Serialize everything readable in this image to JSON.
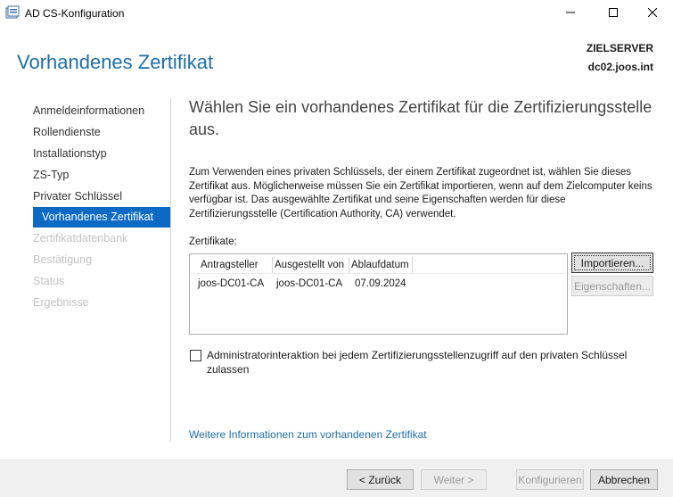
{
  "window": {
    "title": "AD CS-Konfiguration"
  },
  "header": {
    "page_heading": "Vorhandenes Zertifikat",
    "target_label": "ZIELSERVER",
    "target_name": "dc02.joos.int"
  },
  "nav": {
    "items": [
      {
        "label": "Anmeldeinformationen",
        "state": "normal"
      },
      {
        "label": "Rollendienste",
        "state": "normal"
      },
      {
        "label": "Installationstyp",
        "state": "normal"
      },
      {
        "label": "ZS-Typ",
        "state": "normal"
      },
      {
        "label": "Privater Schlüssel",
        "state": "normal"
      },
      {
        "label": "Vorhandenes Zertifikat",
        "state": "active"
      },
      {
        "label": "Zertifikatdatenbank",
        "state": "disabled"
      },
      {
        "label": "Bestätigung",
        "state": "disabled"
      },
      {
        "label": "Status",
        "state": "disabled"
      },
      {
        "label": "Ergebnisse",
        "state": "disabled"
      }
    ]
  },
  "main": {
    "title": "Wählen Sie ein vorhandenes Zertifikat für die Zertifizierungsstelle aus.",
    "description": "Zum Verwenden eines privaten Schlüssels, der einem Zertifikat zugeordnet ist, wählen Sie dieses Zertifikat aus. Möglicherweise müssen Sie ein Zertifikat importieren, wenn auf dem Zielcomputer keins verfügbar ist. Das ausgewählte Zertifikat und seine Eigenschaften werden für diese Zertifizierungsstelle (Certification Authority, CA) verwendet.",
    "list_label": "Zertifikate:",
    "columns": [
      "Antragsteller",
      "Ausgestellt von",
      "Ablaufdatum"
    ],
    "rows": [
      [
        "joos-DC01-CA",
        "joos-DC01-CA",
        "07.09.2024"
      ]
    ],
    "import_button": "Importieren...",
    "properties_button": "Eigenschaften...",
    "checkbox_label": "Administratorinteraktion bei jedem Zertifizierungsstellenzugriff auf den privaten Schlüssel zulassen",
    "checkbox_checked": false,
    "more_link": "Weitere Informationen zum vorhandenen Zertifikat"
  },
  "footer": {
    "back": "< Zurück",
    "next": "Weiter >",
    "configure": "Konfigurieren",
    "cancel": "Abbrechen"
  },
  "colors": {
    "accent": "#0c6ac4",
    "heading": "#1e6ea7",
    "disabled_text": "#c4c4c4"
  }
}
